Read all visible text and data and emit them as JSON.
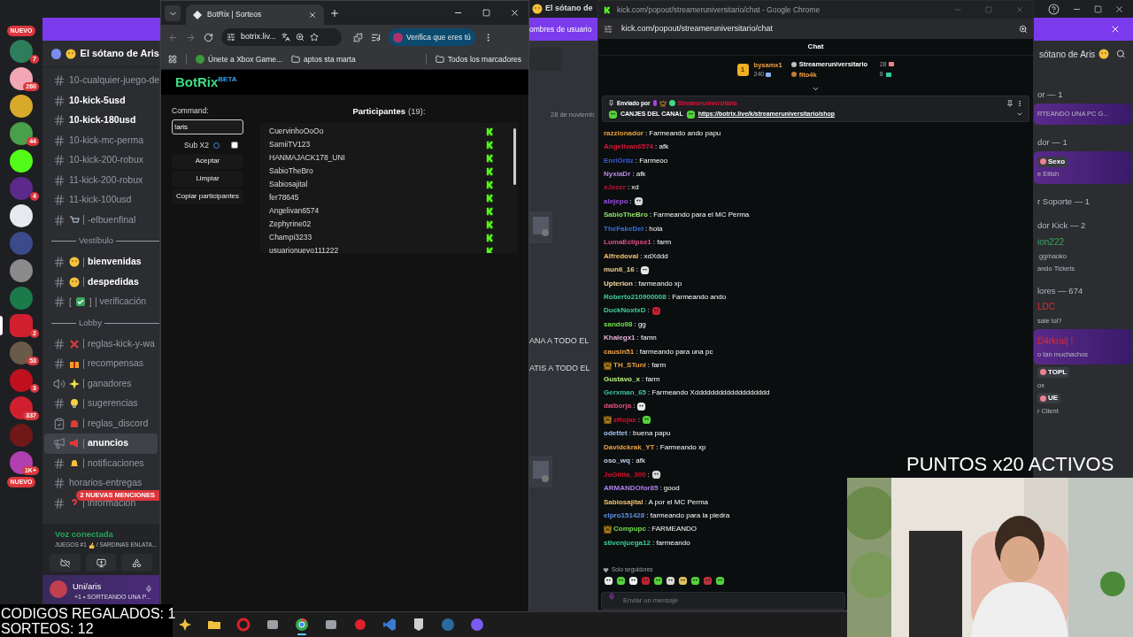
{
  "discord": {
    "title": "El sótano de",
    "banner_left": "ombres de usuario",
    "server_name": "El sótano de Aris",
    "servers": [
      {
        "kind": "pill",
        "text": "NUEVO"
      },
      {
        "kind": "icon",
        "color": "#2e7d5b",
        "badge": "7",
        "selected": false
      },
      {
        "kind": "icon",
        "color": "#f2a7b5",
        "badge": "260",
        "selected": false
      },
      {
        "kind": "icon",
        "color": "#d9a92b",
        "selected": false
      },
      {
        "kind": "icon",
        "color": "#4aa04a",
        "badge": "44",
        "selected": false
      },
      {
        "kind": "icon",
        "color": "#53fc18",
        "selected": false
      },
      {
        "kind": "icon",
        "color": "#5b2a8a",
        "badge": "4",
        "selected": false
      },
      {
        "kind": "icon",
        "color": "#e8e8f0",
        "selected": false
      },
      {
        "kind": "icon",
        "color": "#3a4a8a",
        "selected": false
      },
      {
        "kind": "icon",
        "color": "#8a8a8a",
        "selected": false
      },
      {
        "kind": "icon",
        "color": "#1a7a4a",
        "selected": false
      },
      {
        "kind": "icon",
        "color": "#d02030",
        "badge": "2",
        "selected": true
      },
      {
        "kind": "icon",
        "color": "#6a5a4a",
        "badge": "53",
        "selected": false
      },
      {
        "kind": "icon",
        "color": "#c01020",
        "badge": "3",
        "selected": false
      },
      {
        "kind": "icon",
        "color": "#d02030",
        "badge": "337",
        "selected": false
      },
      {
        "kind": "icon",
        "color": "#701818",
        "selected": false
      },
      {
        "kind": "icon",
        "color": "#b040b0",
        "badge": "1K+",
        "selected": false
      },
      {
        "kind": "pill",
        "text": "NUEVO"
      }
    ],
    "channels": [
      {
        "kind": "hash",
        "name": "10-cualquier-juego-de",
        "unread": false,
        "selected": false
      },
      {
        "kind": "hash",
        "name": "10-kick-5usd",
        "unread": true,
        "selected": false
      },
      {
        "kind": "hash",
        "name": "10-kick-180usd",
        "unread": true,
        "selected": false
      },
      {
        "kind": "hash",
        "name": "10-kick-mc-perma",
        "unread": false,
        "selected": false
      },
      {
        "kind": "hash",
        "name": "10-kick-200-robux",
        "unread": false,
        "selected": false
      },
      {
        "kind": "hash",
        "name": "11-kick-200-robux",
        "unread": false,
        "selected": false
      },
      {
        "kind": "hash",
        "name": "11-kick-100usd",
        "unread": false,
        "selected": false
      },
      {
        "kind": "hash",
        "emoji": {
          "kind": "cart"
        },
        "name": "-elbuenfinal",
        "unread": false,
        "selected": false
      },
      {
        "kind": "category",
        "name": "Vestíbulo"
      },
      {
        "kind": "hash",
        "emoji": {
          "kind": "smile"
        },
        "name": "bienvenidas",
        "unread": true,
        "selected": false
      },
      {
        "kind": "hash",
        "emoji": {
          "kind": "sad"
        },
        "name": "despedidas",
        "unread": true,
        "selected": false
      },
      {
        "kind": "hash",
        "emoji": {
          "kind": "check"
        },
        "wrap": [
          "[",
          "]"
        ],
        "name": "verificación",
        "unread": false,
        "selected": false
      },
      {
        "kind": "category",
        "name": "Lobby"
      },
      {
        "kind": "hash",
        "emoji": {
          "kind": "cross"
        },
        "name": "reglas-kick-y-wa",
        "unread": false,
        "selected": false
      },
      {
        "kind": "hash",
        "emoji": {
          "kind": "gift"
        },
        "name": "recompensas",
        "unread": false,
        "selected": false
      },
      {
        "kind": "stage",
        "emoji": {
          "kind": "sparkle"
        },
        "name": "ganadores",
        "unread": false,
        "selected": false
      },
      {
        "kind": "hash",
        "emoji": {
          "kind": "bulb"
        },
        "name": "sugerencias",
        "unread": false,
        "selected": false
      },
      {
        "kind": "rules",
        "emoji": {
          "kind": "siren"
        },
        "name": "reglas_discord",
        "unread": false,
        "selected": false
      },
      {
        "kind": "announce",
        "emoji": {
          "kind": "megaphone"
        },
        "name": "anuncios",
        "unread": false,
        "selected": true
      },
      {
        "kind": "hash",
        "emoji": {
          "kind": "bell"
        },
        "name": "notificaciones",
        "unread": false,
        "selected": false
      },
      {
        "kind": "hash",
        "name": "horarios-entregas",
        "unread": false,
        "selected": false
      },
      {
        "kind": "hash",
        "emoji": {
          "kind": "question"
        },
        "name": "información",
        "unread": false,
        "selected": false
      }
    ],
    "mentions": "2 NUEVAS MENCIONES",
    "voice": {
      "status": "Voz conectada",
      "channel_a": "JUEGOS #1",
      "channel_b": "/ SARDINAS ENLATA..."
    },
    "user": {
      "name": "Uni/aris",
      "activity": "+1 • SORTEANDO UNA P..."
    },
    "chat_strip": {
      "date": "28 de noviemb",
      "lines": [
        "ANA A TODO EL",
        "ATIS A TODO EL"
      ]
    },
    "members_header": "sótano de Aris",
    "members": [
      {
        "kind": "heading",
        "text": "or — 1"
      },
      {
        "kind": "card",
        "lines": [
          {
            "kind": "status",
            "text": "RTEANDO UNA PC G..."
          }
        ]
      },
      {
        "kind": "heading",
        "text": "dor — 1"
      },
      {
        "kind": "card",
        "lines": [
          {
            "kind": "tag",
            "text": "Sexo"
          },
          {
            "kind": "status",
            "text": "e Eilish"
          }
        ]
      },
      {
        "kind": "heading",
        "text": "r Soporte — 1"
      },
      {
        "kind": "heading",
        "text": "dor Kick — 2"
      },
      {
        "kind": "name",
        "text": "ion222",
        "color": "#3ba55d"
      },
      {
        "kind": "status",
        "text": ".gg/naoko"
      },
      {
        "kind": "status",
        "text": "ando Tickets"
      },
      {
        "kind": "heading",
        "text": "lores — 674"
      },
      {
        "kind": "name",
        "text": "LDC",
        "color": "#e02b2b"
      },
      {
        "kind": "status",
        "text": "sale lol?"
      },
      {
        "kind": "card",
        "lines": [
          {
            "kind": "name",
            "text": "D4rkrai| !",
            "color": "#e02b2b"
          },
          {
            "kind": "status",
            "text": "o tan muchachos"
          }
        ]
      },
      {
        "kind": "tag",
        "text": "TOPL"
      },
      {
        "kind": "status",
        "text": "ox"
      },
      {
        "kind": "tag",
        "text": "UE"
      },
      {
        "kind": "status",
        "text": "r Client"
      }
    ]
  },
  "botrix_window": {
    "tab": "BotRix | Sorteos",
    "url": "botrix.liv...",
    "verify": "Verifica que eres tú",
    "bookmarks": [
      "Únete a Xbox Game...",
      "aptos sta marta"
    ],
    "all_bookmarks": "Todos los marcadores",
    "logo": "BotRix",
    "beta": "BETA",
    "command_label": "Command:",
    "command_value": "!aris",
    "sub_label": "Sub X2",
    "sub_checked": false,
    "buttons": [
      "Aceptar",
      "Limpiar",
      "Copiar participantes"
    ],
    "participants_label": "Participantes",
    "participants_count": "(19):",
    "participants": [
      "CuervinhoOoOo",
      "SamiiTV123",
      "HANMAJACK178_UNI",
      "SabioTheBro",
      "Sabiosajital",
      "fer78645",
      "Angelivan6574",
      "Zephyrine02",
      "Champi3233",
      "usuarionuevo111222"
    ]
  },
  "kick_window": {
    "title": "kick.com/popout/streameruniversitario/chat - Google Chrome",
    "url": "kick.com/popout/streameruniversitario/chat",
    "chat_title": "Chat",
    "leaderboard": {
      "rank": "1",
      "name": "bysamx1",
      "count": "240",
      "others": [
        {
          "name": "Streameruniversitario",
          "count": "28",
          "color": "#ffffff"
        },
        {
          "name": "fito4k",
          "count": "8",
          "color": "#f0a040"
        }
      ]
    },
    "pinned": {
      "label": "Enviado por",
      "author": "Streameruniversitario",
      "title": "CANJES DEL CANAL",
      "link": "https://botrix.live/k/streameruniversitario/shop"
    },
    "messages": [
      {
        "kind": "text",
        "user": "razzionador",
        "color": "#e9a03b",
        "text": ": Farmeando ando papu",
        "badge": false
      },
      {
        "kind": "text",
        "user": "Angelivan6574",
        "color": "#d11a3b",
        "text": ": afk",
        "badge": false
      },
      {
        "kind": "text",
        "user": "EnriOrtiz",
        "color": "#3a5bd9",
        "text": ": Farmeoo",
        "badge": false
      },
      {
        "kind": "text",
        "user": "NyxiaDr",
        "color": "#b88ae8",
        "text": ": afk",
        "badge": false
      },
      {
        "kind": "text",
        "user": "xJezer",
        "color": "#c0143c",
        "text": ": xd",
        "badge": false
      },
      {
        "kind": "emote",
        "user": "alejepo",
        "color": "#9b4de0",
        "text": ":",
        "badge": false
      },
      {
        "kind": "text",
        "user": "SabioTheBro",
        "color": "#8fe36b",
        "text": ": Farmeando para el MC Perma",
        "badge": false
      },
      {
        "kind": "text",
        "user": "TheFakeDel",
        "color": "#3a6fd9",
        "text": ": hola",
        "badge": false
      },
      {
        "kind": "text",
        "user": "LumaEclipse1",
        "color": "#e0508a",
        "text": ": farm",
        "badge": false
      },
      {
        "kind": "text",
        "user": "Alfredoval",
        "color": "#f0c070",
        "text": ": xdXddd",
        "badge": false
      },
      {
        "kind": "emote",
        "user": "munii_16",
        "color": "#f0d090",
        "text": ":",
        "badge": false
      },
      {
        "kind": "text",
        "user": "Upterion",
        "color": "#f0d8a0",
        "text": ": farmeando xp",
        "badge": false
      },
      {
        "kind": "text",
        "user": "Roberto210900008",
        "color": "#3fd09a",
        "text": ": Farmeando ando",
        "badge": false
      },
      {
        "kind": "emote",
        "user": "DuckNoxtxD",
        "color": "#3fd09a",
        "text": ":",
        "badge": false
      },
      {
        "kind": "text",
        "user": "sando98",
        "color": "#6ee04a",
        "text": ": gg",
        "badge": false
      },
      {
        "kind": "text",
        "user": "Khalegx1",
        "color": "#e8b0d8",
        "text": ": famn",
        "badge": false
      },
      {
        "kind": "text",
        "user": "causin51",
        "color": "#f0a040",
        "text": ": farmeando para una pc",
        "badge": false
      },
      {
        "kind": "text",
        "user": "TH_STuni",
        "color": "#f0a040",
        "text": ": farm",
        "badge": true
      },
      {
        "kind": "text",
        "user": "Gustavo_x",
        "color": "#b8f080",
        "text": ": farm",
        "badge": false
      },
      {
        "kind": "text",
        "user": "Gerxman_65",
        "color": "#3fc0a0",
        "text": ": Farmeando Xddddddddddddddddddd",
        "badge": false
      },
      {
        "kind": "emote",
        "user": "daiborja",
        "color": "#e05080",
        "text": ":",
        "badge": false
      },
      {
        "kind": "emote",
        "user": "zRojas",
        "color": "#d01030",
        "text": ":",
        "badge": true
      },
      {
        "kind": "text",
        "user": "odettet",
        "color": "#a0c0f0",
        "text": ": buena papu",
        "badge": false
      },
      {
        "kind": "text",
        "user": "Davidckrak_YT",
        "color": "#f0a040",
        "text": ": Farmeando xp",
        "badge": false
      },
      {
        "kind": "text",
        "user": "oso_wq",
        "color": "#c0d0f0",
        "text": ": afk",
        "badge": false
      },
      {
        "kind": "emote",
        "user": "JoGitita_300",
        "color": "#d01030",
        "text": ":",
        "badge": false
      },
      {
        "kind": "text",
        "user": "ARMANDOfor85",
        "color": "#b080f0",
        "text": ": good",
        "badge": false
      },
      {
        "kind": "text",
        "user": "Sabiosajital",
        "color": "#f0c070",
        "text": ": A por el MC Perma",
        "badge": false
      },
      {
        "kind": "text",
        "user": "elpro151428",
        "color": "#6090e0",
        "text": ": farmeando para la piedra",
        "badge": false
      },
      {
        "kind": "text",
        "user": "Compupc",
        "color": "#6ee04a",
        "text": ": FARMEANDO",
        "badge": true
      },
      {
        "kind": "text",
        "user": "stivenjuega12",
        "color": "#3fd09a",
        "text": ": farmeando",
        "badge": false
      }
    ],
    "followers_only": "Solo seguidores",
    "input_placeholder": "Enviar un mensaje"
  },
  "taskbar": [
    {
      "kind": "start",
      "active": false
    },
    {
      "kind": "folder",
      "active": false
    },
    {
      "kind": "opera",
      "active": false
    },
    {
      "kind": "app",
      "active": false
    },
    {
      "kind": "chrome",
      "active": true
    },
    {
      "kind": "app",
      "active": false
    },
    {
      "kind": "red",
      "active": false
    },
    {
      "kind": "code",
      "active": false
    },
    {
      "kind": "epic",
      "active": false
    },
    {
      "kind": "steam",
      "active": false
    },
    {
      "kind": "purple",
      "active": false
    }
  ],
  "overlays": {
    "points": "PUNTOS x20 ACTIVOS",
    "codes": "CODIGOS REGALADOS: 1",
    "raffles": "SORTEOS: 12"
  }
}
